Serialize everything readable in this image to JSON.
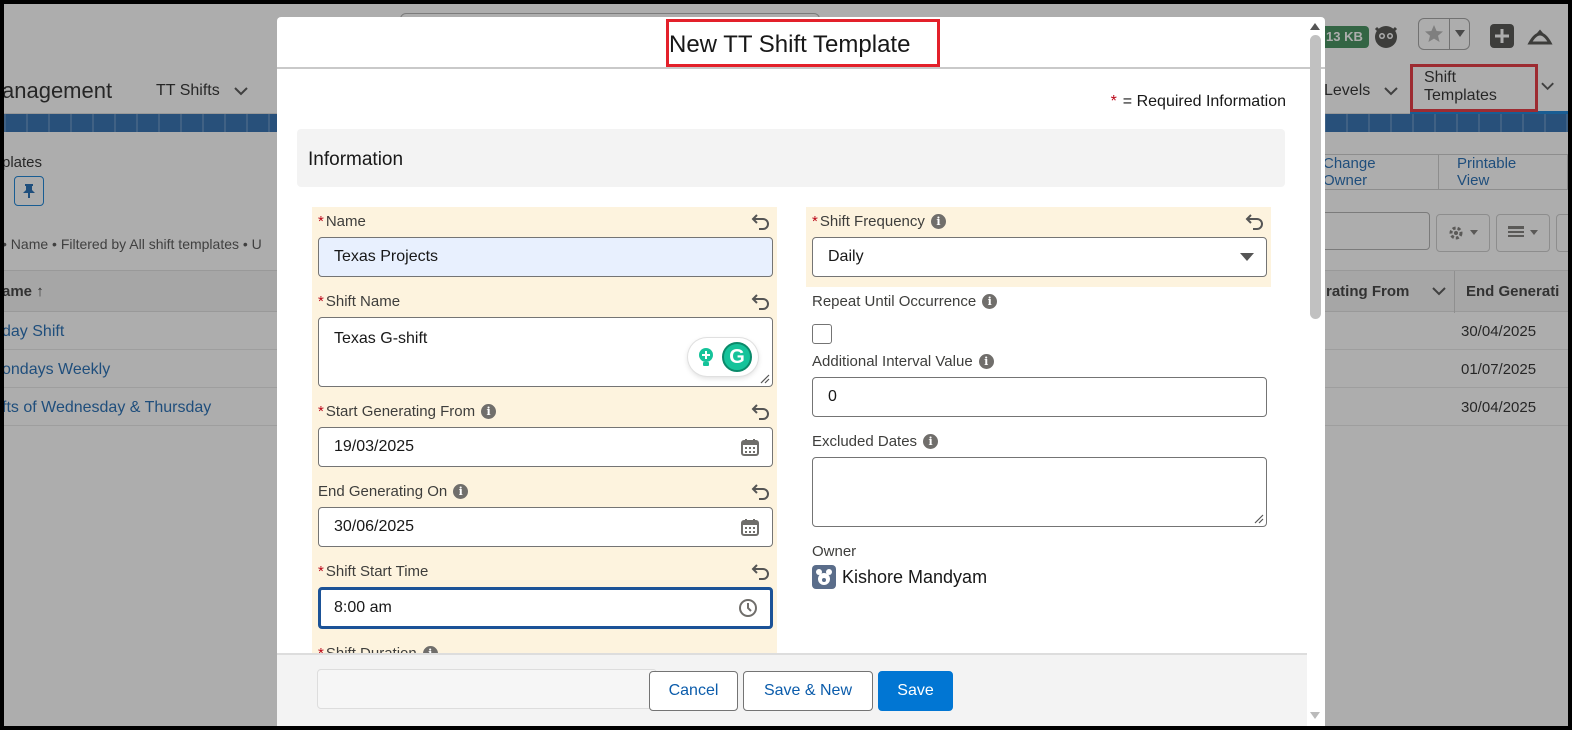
{
  "header": {
    "storage_badge": "13 KB"
  },
  "nav": {
    "app_name": "anagement",
    "items": [
      {
        "label": "TT Shifts"
      },
      {
        "label": "Levels"
      },
      {
        "label": "Shift Templates"
      }
    ]
  },
  "list": {
    "title": "plates",
    "meta": "• Name • Filtered by All shift templates • U",
    "columns": {
      "name": "ame ↑",
      "start": "rating From",
      "end": "End Generati"
    },
    "rows": [
      {
        "name": "day Shift",
        "end": "30/04/2025"
      },
      {
        "name": "ondays Weekly",
        "end": "01/07/2025"
      },
      {
        "name": "fts of Wednesday & Thursday",
        "end": "30/04/2025"
      }
    ],
    "actions": {
      "change_owner": "Change Owner",
      "printable_view": "Printable View"
    }
  },
  "modal": {
    "title": "New TT Shift Template",
    "required_info": "= Required Information",
    "required_star": "*",
    "section": "Information",
    "fields": {
      "name": {
        "label": "Name",
        "value": "Texas Projects"
      },
      "shift_name": {
        "label": "Shift Name",
        "value": "Texas G-shift"
      },
      "start_generating_from": {
        "label": "Start Generating From",
        "value": "19/03/2025"
      },
      "end_generating_on": {
        "label": "End Generating On",
        "value": "30/06/2025"
      },
      "shift_start_time": {
        "label": "Shift Start Time",
        "value": "8:00 am"
      },
      "shift_duration": {
        "label": "Shift Duration"
      },
      "shift_frequency": {
        "label": "Shift Frequency",
        "value": "Daily"
      },
      "repeat_until_occurrence": {
        "label": "Repeat Until Occurrence"
      },
      "additional_interval_value": {
        "label": "Additional Interval Value",
        "value": "0"
      },
      "excluded_dates": {
        "label": "Excluded Dates",
        "value": ""
      },
      "owner": {
        "label": "Owner",
        "value": "Kishore Mandyam"
      }
    },
    "footer": {
      "cancel": "Cancel",
      "save_new": "Save & New",
      "save": "Save"
    }
  },
  "colors": {
    "brand": "#0176d3",
    "link": "#0b5cab",
    "highlight_box": "#e3202a",
    "edited_field_bg": "#fdf3de",
    "required_star": "#ba0517"
  }
}
